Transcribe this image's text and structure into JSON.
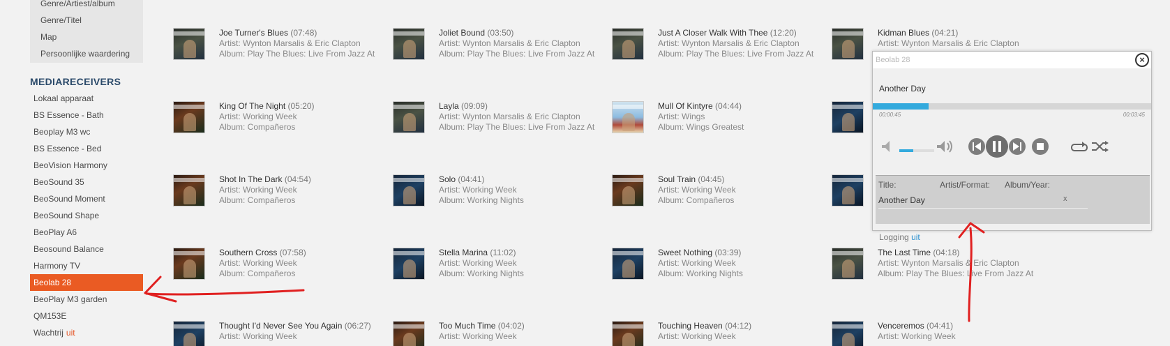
{
  "sidebar": {
    "genre_items": [
      "Genre/Artiest/album",
      "Genre/Titel",
      "Map",
      "Persoonlijke waardering"
    ],
    "section_title": "MEDIARECEIVERS",
    "receivers": [
      "Lokaal apparaat",
      "BS Essence - Bath",
      "Beoplay M3 wc",
      "BS Essence - Bed",
      "BeoVision Harmony",
      "BeoSound 35",
      "BeoSound Moment",
      "BeoSound Shape",
      "BeoPlay A6",
      "Beosound Balance",
      "Harmony TV",
      "Beolab 28",
      "BeoPlay M3 garden",
      "QM153E",
      "Wachtrij"
    ],
    "active_receiver": "Beolab 28",
    "queue_suffix": "uit"
  },
  "tracks": [
    {
      "title": "Joe Turner's Blues",
      "duration": "(07:48)",
      "artist": "Artist: Wynton Marsalis & Eric Clapton",
      "album": "Album: Play The Blues: Live From Jazz At",
      "art": "mc"
    },
    {
      "title": "Joliet Bound",
      "duration": "(03:50)",
      "artist": "Artist: Wynton Marsalis & Eric Clapton",
      "album": "Album: Play The Blues: Live From Jazz At",
      "art": "mc"
    },
    {
      "title": "Just A Closer Walk With Thee",
      "duration": "(12:20)",
      "artist": "Artist: Wynton Marsalis & Eric Clapton",
      "album": "Album: Play The Blues: Live From Jazz At",
      "art": "mc"
    },
    {
      "title": "Kidman Blues",
      "duration": "(04:21)",
      "artist": "Artist: Wynton Marsalis & Eric Clapton",
      "album": "",
      "art": "mc"
    },
    {
      "title": "King Of The Night",
      "duration": "(05:20)",
      "artist": "Artist: Working Week",
      "album": "Album: Compañeros",
      "art": "ww2"
    },
    {
      "title": "Layla",
      "duration": "(09:09)",
      "artist": "Artist: Wynton Marsalis & Eric Clapton",
      "album": "Album: Play The Blues: Live From Jazz At",
      "art": "mc"
    },
    {
      "title": "Mull Of Kintyre",
      "duration": "(04:44)",
      "artist": "Artist: Wings",
      "album": "Album: Wings Greatest",
      "art": "wings"
    },
    {
      "title": "",
      "duration": "",
      "artist": "",
      "album": "",
      "art": "ww"
    },
    {
      "title": "Shot In The Dark",
      "duration": "(04:54)",
      "artist": "Artist: Working Week",
      "album": "Album: Compañeros",
      "art": "ww2"
    },
    {
      "title": "Solo",
      "duration": "(04:41)",
      "artist": "Artist: Working Week",
      "album": "Album: Working Nights",
      "art": "ww"
    },
    {
      "title": "Soul Train",
      "duration": "(04:45)",
      "artist": "Artist: Working Week",
      "album": "Album: Compañeros",
      "art": "ww2"
    },
    {
      "title": "",
      "duration": "",
      "artist": "",
      "album": "",
      "art": "ww"
    },
    {
      "title": "Southern Cross",
      "duration": "(07:58)",
      "artist": "Artist: Working Week",
      "album": "Album: Compañeros",
      "art": "ww2"
    },
    {
      "title": "Stella Marina",
      "duration": "(11:02)",
      "artist": "Artist: Working Week",
      "album": "Album: Working Nights",
      "art": "ww"
    },
    {
      "title": "Sweet Nothing",
      "duration": "(03:39)",
      "artist": "Artist: Working Week",
      "album": "Album: Working Nights",
      "art": "ww"
    },
    {
      "title": "The Last Time",
      "duration": "(04:18)",
      "artist": "Artist: Wynton Marsalis & Eric Clapton",
      "album": "Album: Play The Blues: Live From Jazz At",
      "art": "mc"
    },
    {
      "title": "Thought I'd Never See You Again",
      "duration": "(06:27)",
      "artist": "Artist: Working Week",
      "album": "",
      "art": "ww"
    },
    {
      "title": "Too Much Time",
      "duration": "(04:02)",
      "artist": "Artist: Working Week",
      "album": "",
      "art": "ww2"
    },
    {
      "title": "Touching Heaven",
      "duration": "(04:12)",
      "artist": "Artist: Working Week",
      "album": "",
      "art": "ww2"
    },
    {
      "title": "Venceremos",
      "duration": "(04:41)",
      "artist": "Artist: Working Week",
      "album": "",
      "art": "ww"
    }
  ],
  "player": {
    "window_title": "Beolab 28",
    "close_label": "×",
    "now_playing": "Another Day",
    "elapsed": "00:00:45",
    "total": "00:03:45",
    "progress_fraction": 0.2,
    "volume_fraction": 0.4,
    "info_columns": [
      "Title:",
      "Artist/Format:",
      "Album/Year:"
    ],
    "info_title": "Another Day",
    "info_remove": "x",
    "login_text": "Logging",
    "login_link": "uit",
    "accent": "#33aadd"
  },
  "colors": {
    "active_receiver_bg": "#ea5b23",
    "annotation_arrow": "#e02020"
  }
}
